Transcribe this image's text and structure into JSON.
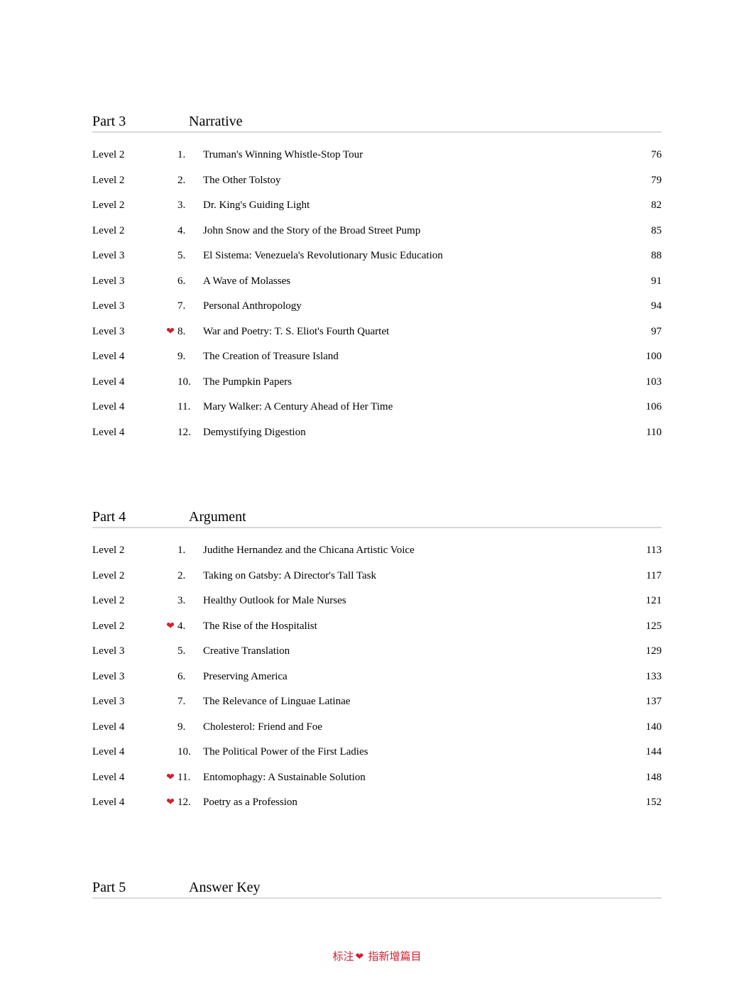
{
  "part3": {
    "label": "Part 3",
    "title": "Narrative",
    "rows": [
      {
        "level": "Level 2",
        "heart": false,
        "num": "1.",
        "title": "Truman's Winning Whistle-Stop Tour",
        "page": "76"
      },
      {
        "level": "Level 2",
        "heart": false,
        "num": "2.",
        "title": "The Other Tolstoy",
        "page": "79"
      },
      {
        "level": "Level 2",
        "heart": false,
        "num": "3.",
        "title": "Dr. King's Guiding Light",
        "page": "82"
      },
      {
        "level": "Level 2",
        "heart": false,
        "num": "4.",
        "title": "John Snow and the Story of the Broad Street Pump",
        "page": "85"
      },
      {
        "level": "Level 3",
        "heart": false,
        "num": "5.",
        "title": "El Sistema: Venezuela's Revolutionary Music Education",
        "page": "88"
      },
      {
        "level": "Level 3",
        "heart": false,
        "num": "6.",
        "title": "A Wave of Molasses",
        "page": "91"
      },
      {
        "level": "Level 3",
        "heart": false,
        "num": "7.",
        "title": "Personal Anthropology",
        "page": "94"
      },
      {
        "level": "Level 3",
        "heart": true,
        "num": "8.",
        "title": "War and Poetry: T. S. Eliot's Fourth Quartet",
        "page": "97"
      },
      {
        "level": "Level 4",
        "heart": false,
        "num": "9.",
        "title": "The Creation of Treasure Island",
        "page": "100"
      },
      {
        "level": "Level 4",
        "heart": false,
        "num": "10.",
        "title": "The Pumpkin Papers",
        "page": "103"
      },
      {
        "level": "Level 4",
        "heart": false,
        "num": "11.",
        "title": "Mary Walker: A Century Ahead of Her Time",
        "page": "106"
      },
      {
        "level": "Level 4",
        "heart": false,
        "num": "12.",
        "title": "Demystifying Digestion",
        "page": "110"
      }
    ]
  },
  "part4": {
    "label": "Part 4",
    "title": "Argument",
    "rows": [
      {
        "level": "Level 2",
        "heart": false,
        "num": "1.",
        "title": "Judithe Hernandez and the Chicana Artistic Voice",
        "page": "113"
      },
      {
        "level": "Level 2",
        "heart": false,
        "num": "2.",
        "title": "Taking on Gatsby: A Director's Tall Task",
        "page": "117"
      },
      {
        "level": "Level 2",
        "heart": false,
        "num": "3.",
        "title": "Healthy Outlook for Male Nurses",
        "page": "121"
      },
      {
        "level": "Level 2",
        "heart": true,
        "num": "4.",
        "title": "The Rise of the Hospitalist",
        "page": "125"
      },
      {
        "level": "Level 3",
        "heart": false,
        "num": "5.",
        "title": "Creative Translation",
        "page": "129"
      },
      {
        "level": "Level 3",
        "heart": false,
        "num": "6.",
        "title": "Preserving America",
        "page": "133"
      },
      {
        "level": "Level 3",
        "heart": false,
        "num": "7.",
        "title": "The Relevance of Linguae Latinae",
        "page": "137"
      },
      {
        "level": "Level 4",
        "heart": false,
        "num": "9.",
        "title": "Cholesterol: Friend and Foe",
        "page": "140"
      },
      {
        "level": "Level 4",
        "heart": false,
        "num": "10.",
        "title": "The Political Power of the First Ladies",
        "page": "144"
      },
      {
        "level": "Level 4",
        "heart": true,
        "num": "11.",
        "title": "Entomophagy: A Sustainable Solution",
        "page": "148"
      },
      {
        "level": "Level 4",
        "heart": true,
        "num": "12.",
        "title": "Poetry as a Profession",
        "page": "152"
      }
    ]
  },
  "part5": {
    "label": "Part 5",
    "title": "Answer Key"
  },
  "heart_glyph": "❤",
  "legend": {
    "prefix": "标注",
    "suffix": " 指新增篇目"
  }
}
